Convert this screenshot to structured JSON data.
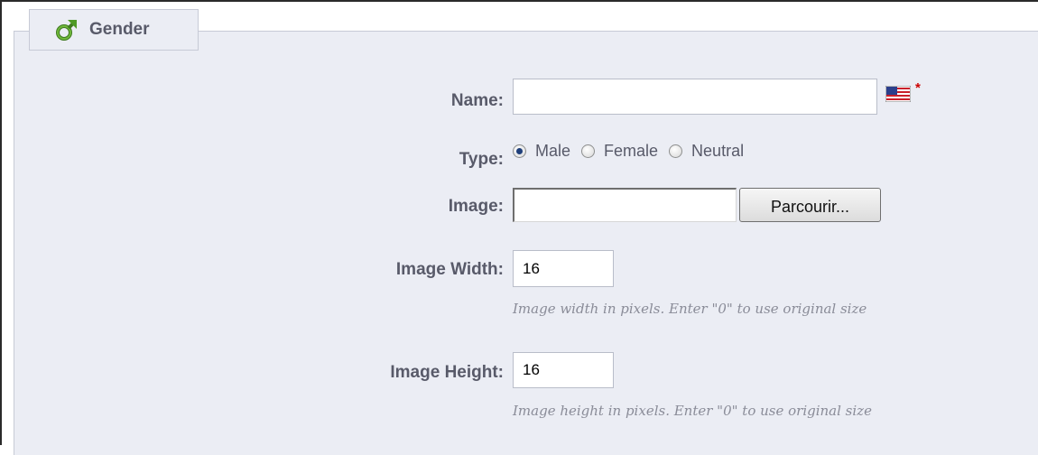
{
  "section": {
    "title": "Gender",
    "icon": "male-gender-icon"
  },
  "fields": {
    "name": {
      "label": "Name:",
      "value": "",
      "language_icon": "us-flag-icon",
      "required_mark": "*"
    },
    "type": {
      "label": "Type:",
      "options": [
        "Male",
        "Female",
        "Neutral"
      ],
      "selected": "Male"
    },
    "image": {
      "label": "Image:",
      "value": "",
      "browse_label": "Parcourir..."
    },
    "image_width": {
      "label": "Image Width:",
      "value": "16",
      "hint": "Image width in pixels. Enter \"0\" to use original size"
    },
    "image_height": {
      "label": "Image Height:",
      "value": "16",
      "hint": "Image height in pixels. Enter \"0\" to use original size"
    }
  },
  "colors": {
    "panel_background": "#ebedf4",
    "label_text": "#585a69",
    "required": "#cc0000"
  }
}
